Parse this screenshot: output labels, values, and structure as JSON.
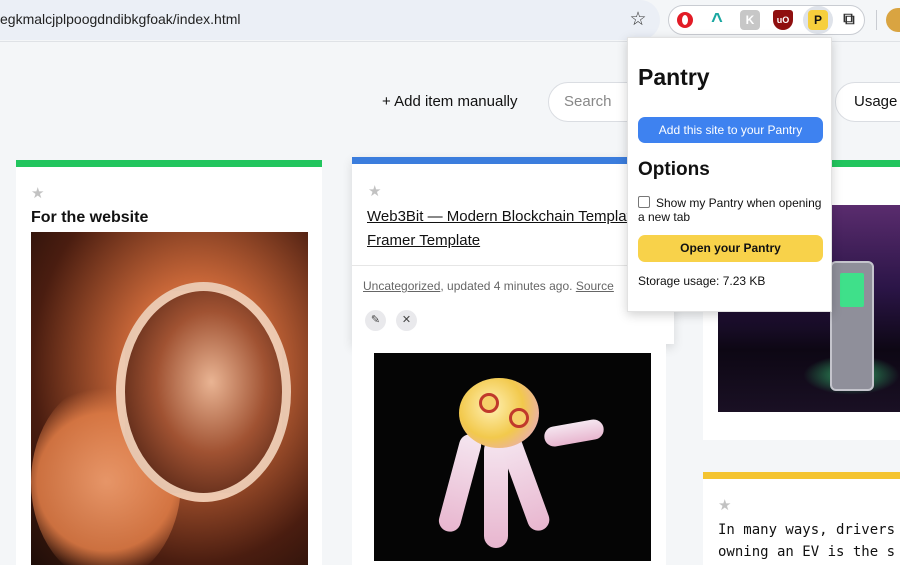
{
  "browser": {
    "url": "egkmalcjplpoogdndibkgfoak/index.html",
    "bookmark_icon": "star-outline-icon",
    "extensions": [
      {
        "name": "opera-icon",
        "label": ""
      },
      {
        "name": "arch-icon",
        "label": "^"
      },
      {
        "name": "k-extension-icon",
        "label": "K"
      },
      {
        "name": "ublock-icon",
        "label": "uO"
      },
      {
        "name": "pantry-extension-icon",
        "label": "P"
      },
      {
        "name": "puzzle-icon",
        "label": "⧉"
      }
    ]
  },
  "toolbar": {
    "add_item": "+ Add item manually",
    "search_placeholder": "Search",
    "usage_button": "Usage"
  },
  "cards": {
    "card1": {
      "title": "For the website",
      "accent": "#22c55e"
    },
    "card2": {
      "title": "Web3Bit — Modern Blockchain Template — Framer Template",
      "category": "Uncategorized",
      "updated": ", updated 4 minutes ago. ",
      "source": "Source",
      "accent": "#3b7ddd"
    },
    "card3": {
      "accent": "#22c55e"
    },
    "card4": {
      "line1": "In many ways, drivers",
      "line2": "owning an EV is the s",
      "accent": "#f4c430"
    }
  },
  "popup": {
    "title": "Pantry",
    "add_site_button": "Add this site to your Pantry",
    "options_heading": "Options",
    "show_pantry_label": "Show my Pantry when opening a new tab",
    "show_pantry_checked": false,
    "open_pantry_button": "Open your Pantry",
    "storage_usage": "Storage usage: 7.23 KB"
  },
  "colors": {
    "primary_blue": "#3e82f0",
    "yellow": "#f8d24a",
    "green": "#22c55e"
  }
}
